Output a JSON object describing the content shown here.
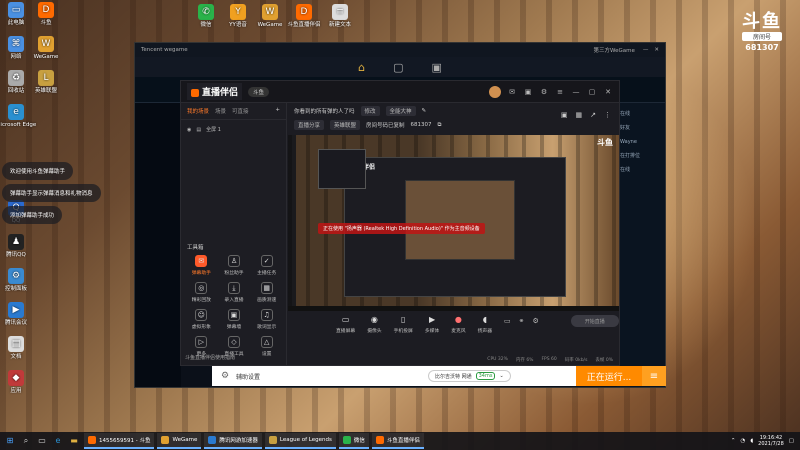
{
  "watermark": {
    "logo": "斗鱼",
    "sub": "房间号",
    "room": "681307"
  },
  "desktop_top": [
    {
      "label": "微信",
      "icon": "wechat-icon",
      "color": "#2ab34a",
      "glyph": "✆"
    },
    {
      "label": "YY语音",
      "icon": "yy-icon",
      "color": "#f0a020",
      "glyph": "Y"
    },
    {
      "label": "WeGame",
      "icon": "wegame-icon",
      "color": "#e0a030",
      "glyph": "W"
    },
    {
      "label": "斗鱼直播伴侣",
      "icon": "douyu-icon",
      "color": "#ff6a00",
      "glyph": "D"
    },
    {
      "label": "新建文本",
      "icon": "text-file-icon",
      "color": "#ddd",
      "glyph": "≡"
    }
  ],
  "desktop_left": [
    {
      "label": "此电脑",
      "icon": "computer-icon",
      "color": "#4a90e2",
      "glyph": "▭"
    },
    {
      "label": "网络",
      "icon": "network-icon",
      "color": "#4a90e2",
      "glyph": "⌘"
    },
    {
      "label": "回收站",
      "icon": "recycle-bin-icon",
      "color": "#aaa",
      "glyph": "♻"
    },
    {
      "label": "Microsoft Edge",
      "icon": "edge-icon",
      "color": "#2a90d0",
      "glyph": "e"
    },
    {
      "label": "QQ",
      "icon": "qq-icon",
      "color": "#2a6ad0",
      "glyph": "Q"
    },
    {
      "label": "腾讯QQ",
      "icon": "qq-penguin-icon",
      "color": "#222",
      "glyph": "♟"
    },
    {
      "label": "控制面板",
      "icon": "control-panel-icon",
      "color": "#3a8ad0",
      "glyph": "⚙"
    },
    {
      "label": "腾讯会议",
      "icon": "meeting-icon",
      "color": "#2a7ad0",
      "glyph": "▶"
    },
    {
      "label": "文档",
      "icon": "document-icon",
      "color": "#ddd",
      "glyph": "▤"
    },
    {
      "label": "应用",
      "icon": "app-icon",
      "color": "#c03a3a",
      "glyph": "◆"
    }
  ],
  "desktop_col2": [
    {
      "label": "斗鱼",
      "icon": "douyu-small-icon",
      "color": "#ff6a00",
      "glyph": "D"
    },
    {
      "label": "WeGame",
      "icon": "wegame-small-icon",
      "color": "#e0a030",
      "glyph": "W"
    },
    {
      "label": "英雄联盟",
      "icon": "lol-icon",
      "color": "#c8a040",
      "glyph": "L"
    }
  ],
  "toasts": [
    "欢迎使用斗鱼弹幕助手",
    "弹幕助手显示弹幕消息和礼物消息",
    "添加弹幕助手成功"
  ],
  "wegame": {
    "title": "Tencent wegame",
    "right_title": "第三方WeGame",
    "nav_icons": [
      "home-icon",
      "chat-icon",
      "controller-icon"
    ]
  },
  "lol_right_items": [
    "在线",
    "好友",
    "Wayne",
    "在打排位",
    "在线"
  ],
  "companion": {
    "logo": "直播伴侣",
    "badge": "斗鱼",
    "tabs": [
      "我的场景",
      "场景",
      "可直接"
    ],
    "scene_label": "全屏 1",
    "tools_title": "工具箱",
    "tools": [
      {
        "label": "弹幕助手",
        "icon": "danmaku-icon",
        "on": true,
        "glyph": "✉"
      },
      {
        "label": "粉丝助手",
        "icon": "fans-icon",
        "on": false,
        "glyph": "♙"
      },
      {
        "label": "主播任务",
        "icon": "task-icon",
        "on": false,
        "glyph": "✓"
      },
      {
        "label": "精彩回放",
        "icon": "replay-icon",
        "on": false,
        "glyph": "◎"
      },
      {
        "label": "录入直播",
        "icon": "record-icon",
        "on": false,
        "glyph": "⤓"
      },
      {
        "label": "画质测速",
        "icon": "speed-icon",
        "on": false,
        "glyph": "▦"
      },
      {
        "label": "虚拟形象",
        "icon": "avatar-icon",
        "on": false,
        "glyph": "☺"
      },
      {
        "label": "弹幕墙",
        "icon": "wall-icon",
        "on": false,
        "glyph": "▣"
      },
      {
        "label": "歌词显示",
        "icon": "lyrics-icon",
        "on": false,
        "glyph": "♫"
      },
      {
        "label": "更多",
        "icon": "more-icon",
        "on": false,
        "glyph": "▷"
      },
      {
        "label": "直播工具",
        "icon": "tools-icon",
        "on": false,
        "glyph": "◇"
      },
      {
        "label": "设置",
        "icon": "settings-icon",
        "on": false,
        "glyph": "△"
      }
    ],
    "left_bottom": "斗鱼直播伴侣使用指南",
    "info": {
      "title": "你看到的所有弹的人了吗",
      "edit": "修改",
      "category": "英雄联盟",
      "category2": "全能大神",
      "room_label": "房间号码已复制",
      "room": "681307",
      "tag": "直播分享"
    },
    "preview_logo": "直播伴侣",
    "preview_dy": "斗鱼",
    "alert": "正在使用 \"扬声器 (Realtek High Definition Audio)\" 作为主音频设备",
    "controls": [
      {
        "label": "直播屏幕",
        "icon": "screen-icon",
        "glyph": "▭"
      },
      {
        "label": "摄像头",
        "icon": "camera-icon",
        "glyph": "◉"
      },
      {
        "label": "手机投屏",
        "icon": "phone-icon",
        "glyph": "▯"
      },
      {
        "label": "多媒体",
        "icon": "media-icon",
        "glyph": "▶"
      },
      {
        "label": "麦克风",
        "icon": "mic-icon",
        "glyph": "●"
      },
      {
        "label": "扬声器",
        "icon": "speaker-icon",
        "glyph": "◖"
      }
    ],
    "start_label": "开始直播",
    "status": [
      "CPU 32%",
      "内存 6%",
      "FPS 60",
      "码率 0kb/s",
      "丢帧 0%"
    ]
  },
  "assistant": {
    "settings_label": "辅助设置",
    "chip_label": "比尔吉沃特 网通",
    "chip_ms": "34ms",
    "running": "正在运行..."
  },
  "taskbar": {
    "apps": [
      {
        "label": "1455659591 - 斗鱼",
        "color": "#ff6a00"
      },
      {
        "label": "WeGame",
        "color": "#e0a030"
      },
      {
        "label": "腾讯网游加速器",
        "color": "#2a7ad0"
      },
      {
        "label": "League of Legends",
        "color": "#c8a040"
      },
      {
        "label": "微信",
        "color": "#2ab34a"
      },
      {
        "label": "斗鱼直播伴侣",
        "color": "#ff6a00"
      }
    ],
    "time": "19:16:42",
    "date": "2021/7/28"
  }
}
